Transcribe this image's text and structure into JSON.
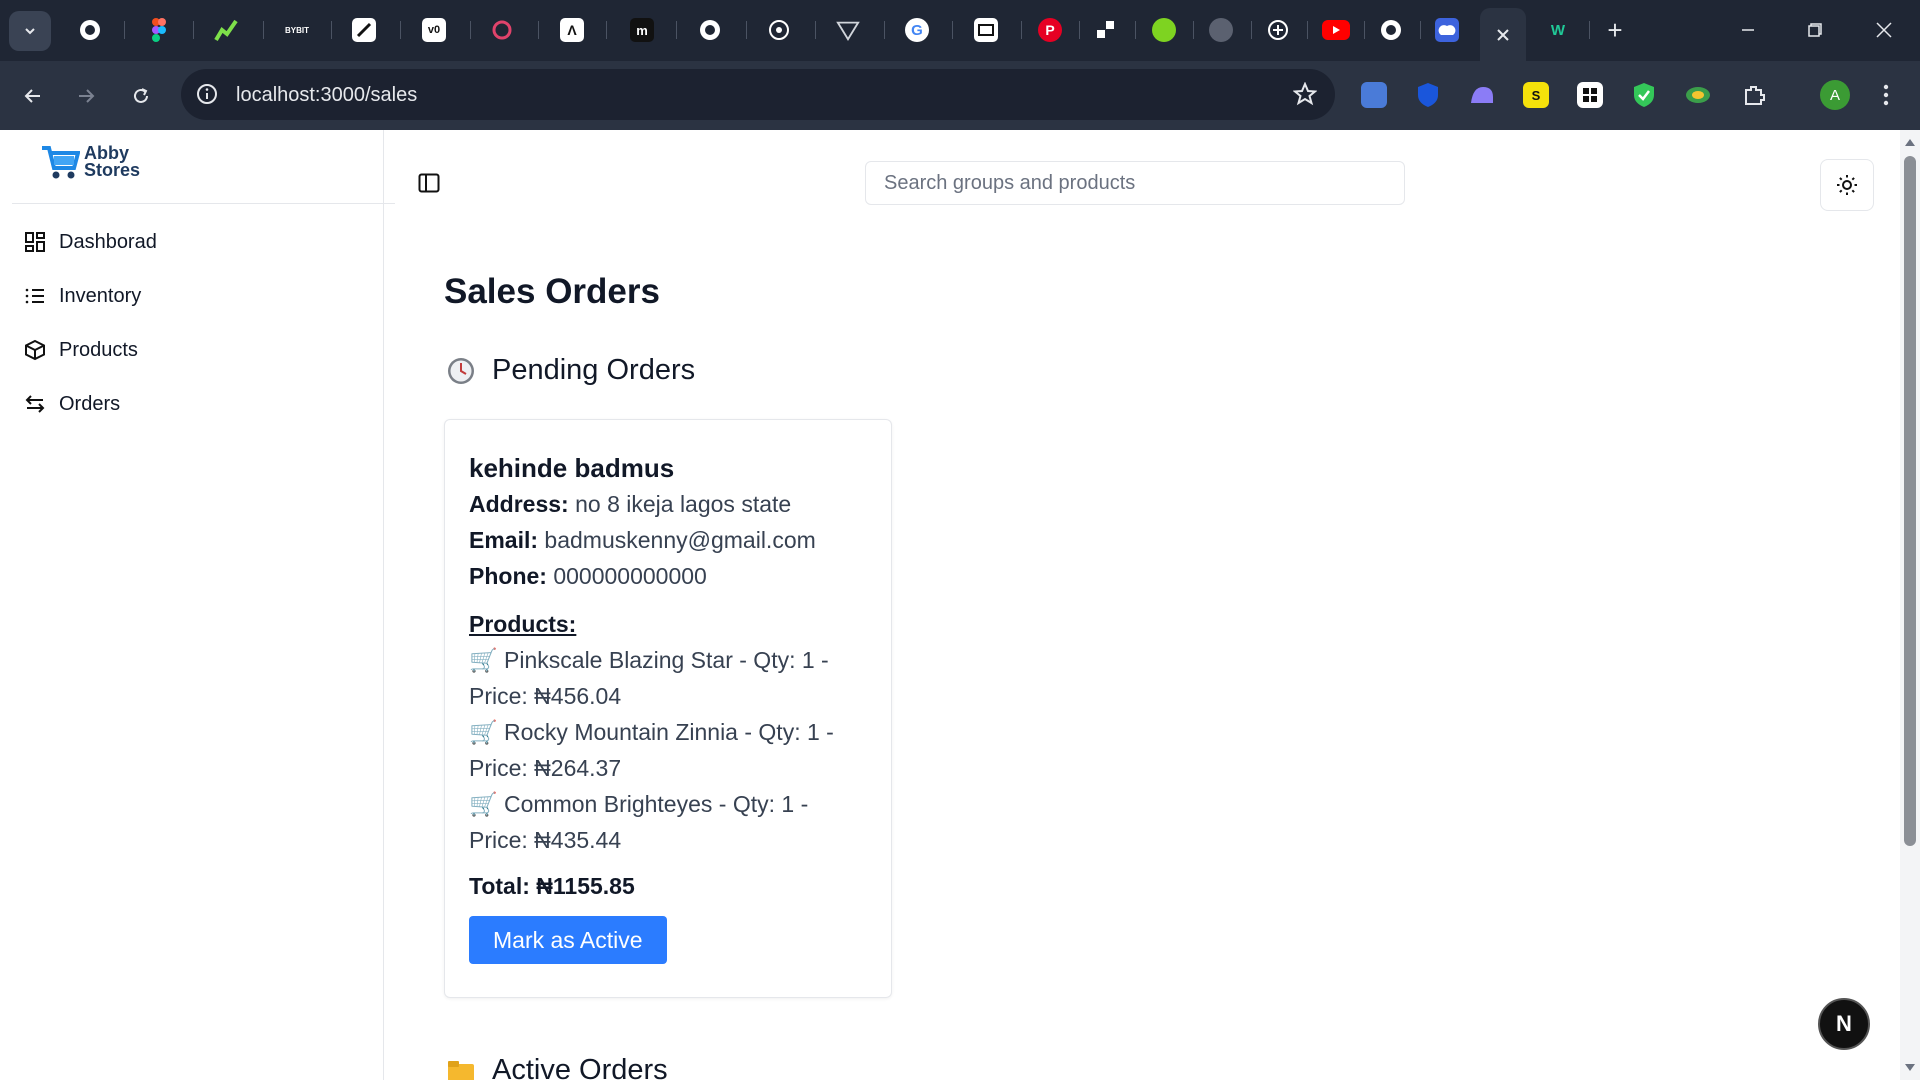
{
  "browser": {
    "url": "localhost:3000/sales",
    "profile_initial": "A",
    "tabs": [
      {
        "icon": "github-icon"
      },
      {
        "icon": "figma-icon"
      },
      {
        "icon": "chart-icon"
      },
      {
        "icon": "bybit-icon",
        "text": "BYBIT"
      },
      {
        "icon": "pen-icon"
      },
      {
        "icon": "v0-icon",
        "text": "v0"
      },
      {
        "icon": "swirl-icon"
      },
      {
        "icon": "lambda-icon"
      },
      {
        "icon": "m-icon",
        "text": "m"
      },
      {
        "icon": "circle-logo-icon"
      },
      {
        "icon": "openai-icon"
      },
      {
        "icon": "triangle-icon"
      },
      {
        "icon": "google-icon",
        "text": "G"
      },
      {
        "icon": "mail-icon"
      },
      {
        "icon": "pinterest-icon",
        "text": "P"
      },
      {
        "icon": "nodes-icon"
      },
      {
        "icon": "green-circle-icon"
      },
      {
        "icon": "globe-icon"
      },
      {
        "icon": "chatgpt-icon"
      },
      {
        "icon": "youtube-icon"
      },
      {
        "icon": "github-icon"
      },
      {
        "icon": "cloud-icon"
      },
      {
        "icon": "close-icon",
        "active": true
      },
      {
        "icon": "w3-icon",
        "text": "W"
      },
      {
        "icon": "new-tab-icon",
        "text": "+"
      }
    ],
    "extensions": [
      {
        "icon": "files-icon"
      },
      {
        "icon": "shield-icon"
      },
      {
        "icon": "ghost-icon"
      },
      {
        "icon": "s-icon",
        "text": "S"
      },
      {
        "icon": "grid-icon"
      },
      {
        "icon": "adblock-icon"
      },
      {
        "icon": "earth-icon"
      },
      {
        "icon": "puzzle-icon"
      }
    ]
  },
  "sidebar": {
    "logo_line1": "Abby",
    "logo_line2": "Stores",
    "items": [
      {
        "label": "Dashborad",
        "icon": "dashboard-icon"
      },
      {
        "label": "Inventory",
        "icon": "list-icon"
      },
      {
        "label": "Products",
        "icon": "package-icon"
      },
      {
        "label": "Orders",
        "icon": "swap-icon"
      }
    ]
  },
  "header": {
    "search_placeholder": "Search groups and products",
    "search_value": ""
  },
  "main": {
    "title": "Sales Orders",
    "pending_heading": "Pending Orders",
    "next_heading": "Active Orders",
    "order": {
      "customer": "kehinde badmus",
      "address_label": "Address:",
      "address": "no 8 ikeja lagos state",
      "email_label": "Email:",
      "email": "badmuskenny@gmail.com",
      "phone_label": "Phone:",
      "phone": "000000000000",
      "products_label": "Products:",
      "products": [
        {
          "cart": "🛒",
          "text": "Pinkscale Blazing Star - Qty: 1 - Price: ₦456.04"
        },
        {
          "cart": "🛒",
          "text": "Rocky Mountain Zinnia - Qty: 1 - Price: ₦264.37"
        },
        {
          "cart": "🛒",
          "text": "Common Brighteyes - Qty: 1 - Price: ₦435.44"
        }
      ],
      "total": "Total: ₦1155.85",
      "button_label": "Mark as Active"
    }
  },
  "fab_label": "N",
  "colors": {
    "accent": "#2b7cff",
    "chrome_dark": "#1f2634",
    "chrome_bar": "#2b3342"
  }
}
